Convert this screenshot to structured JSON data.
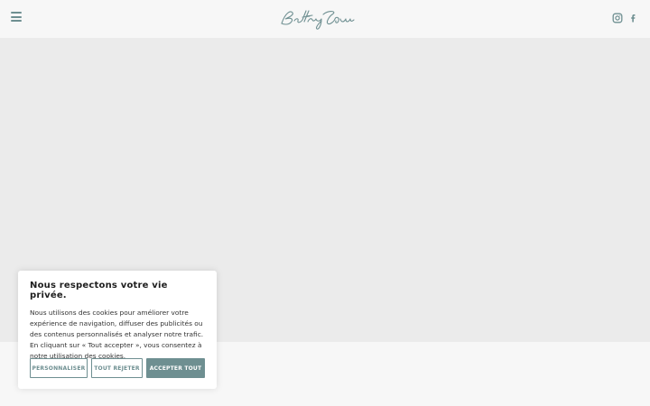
{
  "header": {
    "menu_icon": "hamburger-menu-icon",
    "logo_icon": "script-signature-logo",
    "social": [
      {
        "name": "Instagram",
        "icon": "instagram-icon"
      },
      {
        "name": "Facebook",
        "icon": "facebook-icon"
      }
    ]
  },
  "cookie_banner": {
    "title": "Nous respectons votre vie privée.",
    "body": "Nous utilisons des cookies pour améliorer votre expérience de navigation, diffuser des publicités ou des contenus personnalisés et analyser notre trafic. En cliquant sur « Tout accepter », vous consentez à notre utilisation des cookies.",
    "buttons": {
      "customize": "Personnaliser",
      "reject_all": "Tout rejeter",
      "accept_all": "Accepter tout"
    }
  },
  "colors": {
    "accent": "#6e8f91",
    "header_bg": "#f7f7f7",
    "content_bg": "#ebebeb"
  }
}
